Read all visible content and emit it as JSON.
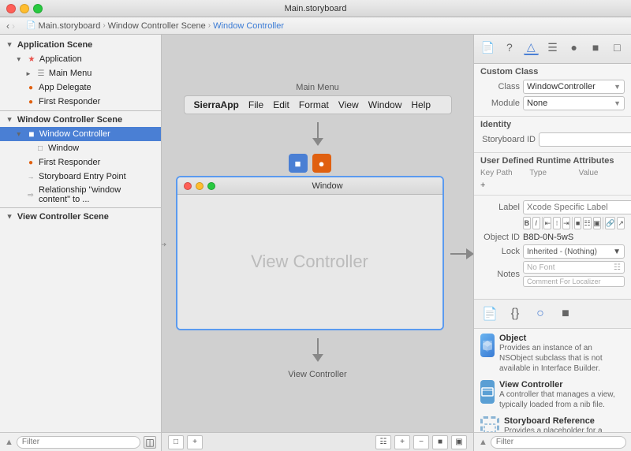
{
  "titlebar": {
    "title": "Main.storyboard",
    "close": "×",
    "min": "−",
    "max": "+"
  },
  "breadcrumb": {
    "items": [
      "Main.storyboard",
      "Window Controller Scene",
      "Window Controller"
    ]
  },
  "sidebar": {
    "filter_placeholder": "Filter",
    "sections": [
      {
        "name": "Application Scene",
        "items": [
          {
            "id": "application",
            "label": "Application",
            "indent": 1,
            "icon": "app",
            "has_triangle": true
          },
          {
            "id": "main-menu",
            "label": "Main Menu",
            "indent": 2,
            "icon": "menu",
            "has_triangle": false
          },
          {
            "id": "app-delegate",
            "label": "App Delegate",
            "indent": 2,
            "icon": "delegate",
            "has_triangle": false
          },
          {
            "id": "first-responder-1",
            "label": "First Responder",
            "indent": 2,
            "icon": "responder",
            "has_triangle": false
          }
        ]
      },
      {
        "name": "Window Controller Scene",
        "items": [
          {
            "id": "window-controller",
            "label": "Window Controller",
            "indent": 1,
            "icon": "wc",
            "selected": true
          },
          {
            "id": "window",
            "label": "Window",
            "indent": 2,
            "icon": "window"
          },
          {
            "id": "first-responder-2",
            "label": "First Responder",
            "indent": 2,
            "icon": "responder"
          },
          {
            "id": "storyboard-entry",
            "label": "Storyboard Entry Point",
            "indent": 2,
            "icon": "arrow"
          },
          {
            "id": "relationship",
            "label": "Relationship \"window content\" to ...",
            "indent": 2,
            "icon": "rel"
          }
        ]
      },
      {
        "name": "View Controller Scene",
        "items": []
      }
    ]
  },
  "canvas": {
    "menu_scene_label": "Main Menu",
    "menu_app_name": "SierraApp",
    "menu_items": [
      "File",
      "Edit",
      "Format",
      "View",
      "Window",
      "Help"
    ],
    "window_title": "Window",
    "vc_placeholder": "View Controller",
    "vc_label": "View Controller"
  },
  "right_panel": {
    "section_custom_class": {
      "title": "Custom Class",
      "class_label": "Class",
      "class_value": "WindowController",
      "module_label": "Module",
      "module_value": "None"
    },
    "section_identity": {
      "title": "Identity",
      "storyboard_id_label": "Storyboard ID"
    },
    "section_runtime": {
      "title": "User Defined Runtime Attributes",
      "key_path_label": "Key Path",
      "type_label": "Type",
      "value_label": "Value"
    },
    "section_document": {
      "label_label": "Label",
      "label_placeholder": "Xcode Specific Label",
      "object_id_label": "Object ID",
      "object_id_value": "B8D-0N-5wS",
      "lock_label": "Lock",
      "lock_value": "Inherited - (Nothing)",
      "notes_label": "Notes",
      "font_placeholder": "No Font",
      "comment_placeholder": "Comment For Localizer"
    },
    "library_items": [
      {
        "icon": "cube",
        "title": "Object",
        "desc": "Provides an instance of an NSObject subclass that is not available in Interface Builder."
      },
      {
        "icon": "vc",
        "title": "View Controller",
        "desc": "A controller that manages a view, typically loaded from a nib file."
      },
      {
        "icon": "sb",
        "title": "Storyboard Reference",
        "desc": "Provides a placeholder for a controller in an external storyboard."
      }
    ],
    "filter_placeholder": "Filter"
  }
}
